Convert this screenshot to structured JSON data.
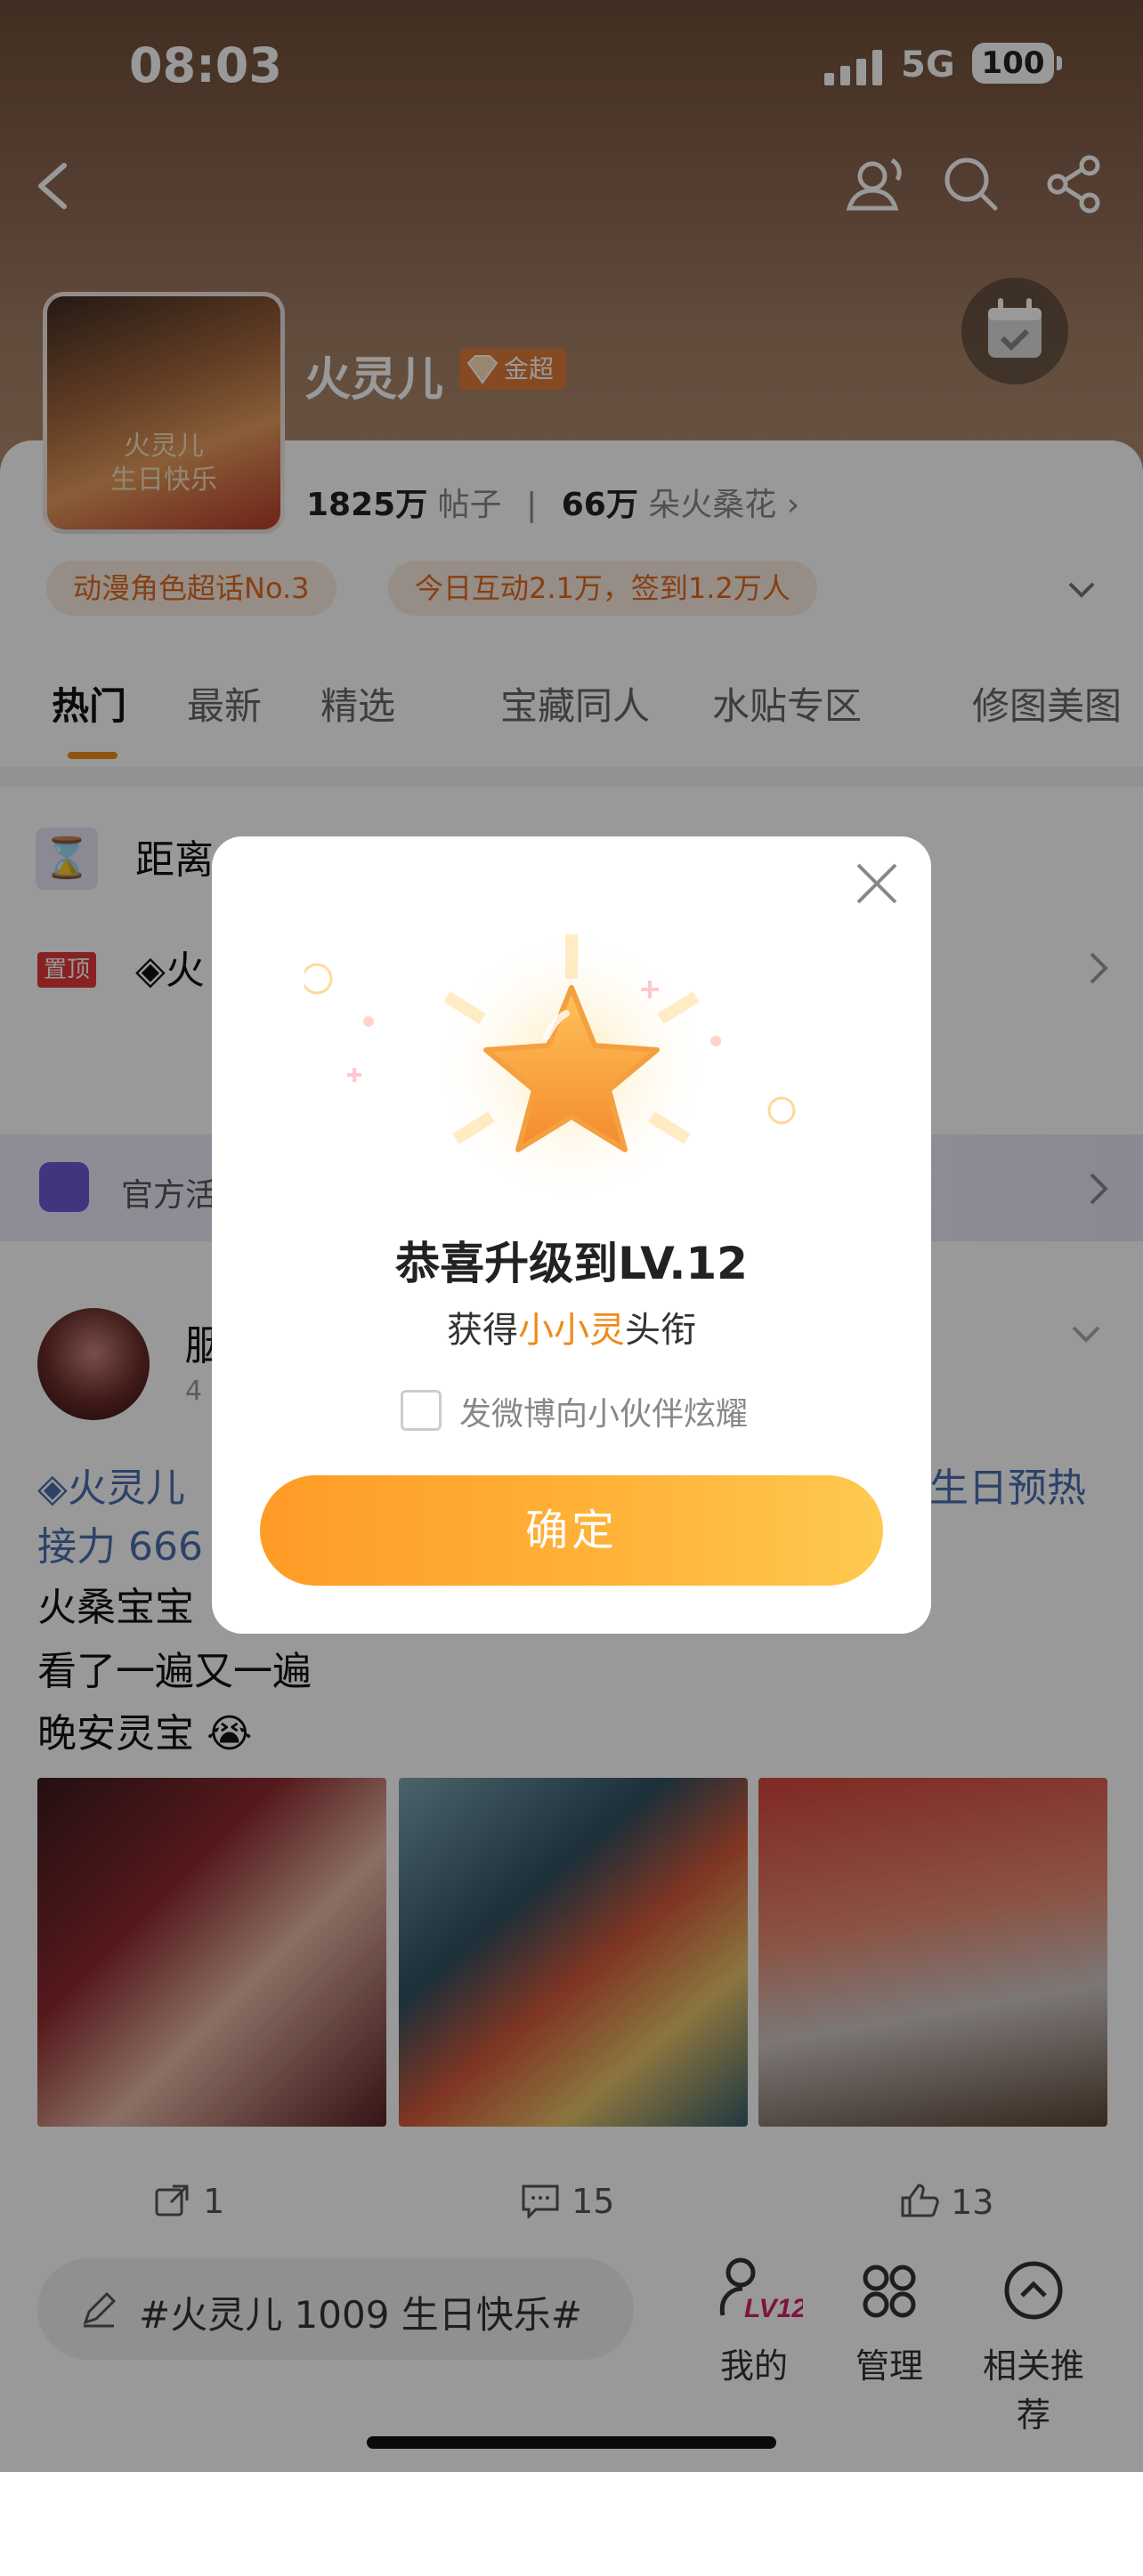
{
  "status": {
    "time": "08:03",
    "network": "5G",
    "battery": "100"
  },
  "header": {
    "title": "火灵儿",
    "badge": "金超"
  },
  "stats": {
    "posts_count": "1825万",
    "posts_label": "帖子",
    "fans_count": "66万",
    "fans_label": "朵火桑花",
    "fans_arrow": "›"
  },
  "tags": [
    "动漫角色超话No.3",
    "今日互动2.1万，签到1.2万人"
  ],
  "tabs": [
    "热门",
    "最新",
    "精选",
    "宝藏同人",
    "水贴专区",
    "修图美图"
  ],
  "pinned": {
    "countdown_text": "距离",
    "pin_badge": "置顶",
    "pin_text": "◈火"
  },
  "official": {
    "label": "官方活"
  },
  "post": {
    "author": "胭",
    "time": "4",
    "link_line1": "◈火灵儿",
    "link_line1_end": "生日预热",
    "link_line2": "接力 666",
    "line3": "火桑宝宝",
    "line4": "看了一遍又一遍",
    "line5": "晚安灵宝 😭"
  },
  "actions": {
    "share": "1",
    "comment": "15",
    "like": "13"
  },
  "bottom": {
    "compose": "#火灵儿 1009 生日快乐#",
    "nav": [
      {
        "label": "我的",
        "level": "LV12"
      },
      {
        "label": "管理"
      },
      {
        "label": "相关推荐"
      }
    ]
  },
  "modal": {
    "title": "恭喜升级到LV.12",
    "sub_prefix": "获得",
    "sub_highlight": "小小灵",
    "sub_suffix": "头衔",
    "checkbox_label": "发微博向小伙伴炫耀",
    "confirm": "确定"
  },
  "colors": {
    "accent": "#f08a1a",
    "link": "#4a6fb0",
    "pin": "#e33a3a"
  }
}
